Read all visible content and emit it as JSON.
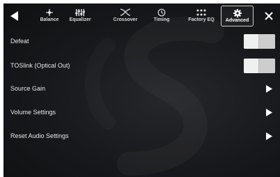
{
  "nav": {
    "back_icon": "back-arrow-icon",
    "close_icon": "close-icon",
    "tabs": [
      {
        "label": "Balance",
        "icon": "balance-icon",
        "active": false
      },
      {
        "label": "Equalizer",
        "icon": "equalizer-icon",
        "active": false
      },
      {
        "label": "Crossover",
        "icon": "crossover-icon",
        "active": false
      },
      {
        "label": "Timing",
        "icon": "timing-icon",
        "active": false
      },
      {
        "label": "Factory EQ",
        "icon": "factory-eq-icon",
        "active": false
      },
      {
        "label": "Advanced",
        "icon": "gear-icon",
        "active": true
      }
    ]
  },
  "settings": {
    "items": [
      {
        "label": "Defeat",
        "control": "toggle",
        "state": "off"
      },
      {
        "label": "TOSlink (Optical Out)",
        "control": "toggle",
        "state": "off"
      },
      {
        "label": "Source Gain",
        "control": "chevron"
      },
      {
        "label": "Volume Settings",
        "control": "chevron"
      },
      {
        "label": "Reset Audio Settings",
        "control": "chevron"
      }
    ]
  },
  "colors": {
    "background": "#17181b",
    "text": "#e8e8e8",
    "toggle_track": "#e6e6e6"
  }
}
